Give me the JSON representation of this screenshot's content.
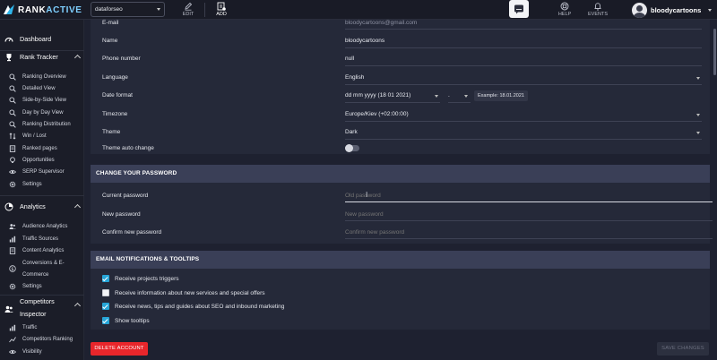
{
  "app": {
    "logo_prefix": "RANK",
    "logo_suffix": "ACTIVE"
  },
  "topbar": {
    "project": "dataforseo",
    "edit_label": "EDIT",
    "add_label": "ADD",
    "help_label": "HELP",
    "events_label": "EVENTS",
    "username": "bloodycartoons"
  },
  "sidebar": {
    "dashboard": "Dashboard",
    "rank_tracker": {
      "title": "Rank Tracker",
      "items": [
        "Ranking Overview",
        "Detailed View",
        "Side-by-Side View",
        "Day by Day View",
        "Ranking Distribution",
        "Win / Lost",
        "Ranked pages",
        "Opportunities",
        "SERP Supervisor",
        "Settings"
      ]
    },
    "analytics": {
      "title": "Analytics",
      "items": [
        "Audience Analytics",
        "Traffic Sources",
        "Content Analytics",
        "Conversions & E-",
        "Commerce",
        "Settings"
      ]
    },
    "competitors": {
      "title_line1": "Competitors",
      "title_line2": "Inspector",
      "items": [
        "Traffic",
        "Competitors Ranking",
        "Visibility"
      ]
    }
  },
  "profile": {
    "email_label": "E-mail",
    "email_value": "bloodycartoons@gmail.com",
    "name_label": "Name",
    "name_value": "bloodycartoons",
    "phone_label": "Phone number",
    "phone_value": "null",
    "language_label": "Language",
    "language_value": "English",
    "date_format_label": "Date format",
    "date_format_value": "dd mm yyyy (18 01 2021)",
    "date_separator_value": ".",
    "example_badge": "Example: 18.01.2021",
    "timezone_label": "Timezone",
    "timezone_value": "Europe/Kiev (+02:00:00)",
    "theme_label": "Theme",
    "theme_value": "Dark",
    "theme_auto_label": "Theme auto change",
    "theme_auto_on": false
  },
  "password": {
    "header": "CHANGE YOUR PASSWORD",
    "current_label": "Current password",
    "current_placeholder": "Old password",
    "new_label": "New password",
    "new_placeholder": "New password",
    "confirm_label": "Confirm new password",
    "confirm_placeholder": "Confirm new password"
  },
  "notifications": {
    "header": "EMAIL NOTIFICATIONS & TOOLTIPS",
    "options": [
      {
        "label": "Receive projects triggers",
        "checked": true
      },
      {
        "label": "Receive information about new services and special offers",
        "checked": false
      },
      {
        "label": "Receive news, tips and guides about SEO and inbound marketing",
        "checked": true
      },
      {
        "label": "Show tooltips",
        "checked": true
      }
    ]
  },
  "actions": {
    "delete_label": "DELETE ACCOUNT",
    "save_label": "SAVE CHANGES"
  },
  "colors": {
    "accent": "#27a6d8",
    "danger": "#e8262b",
    "section_header": "#3a3f57"
  }
}
